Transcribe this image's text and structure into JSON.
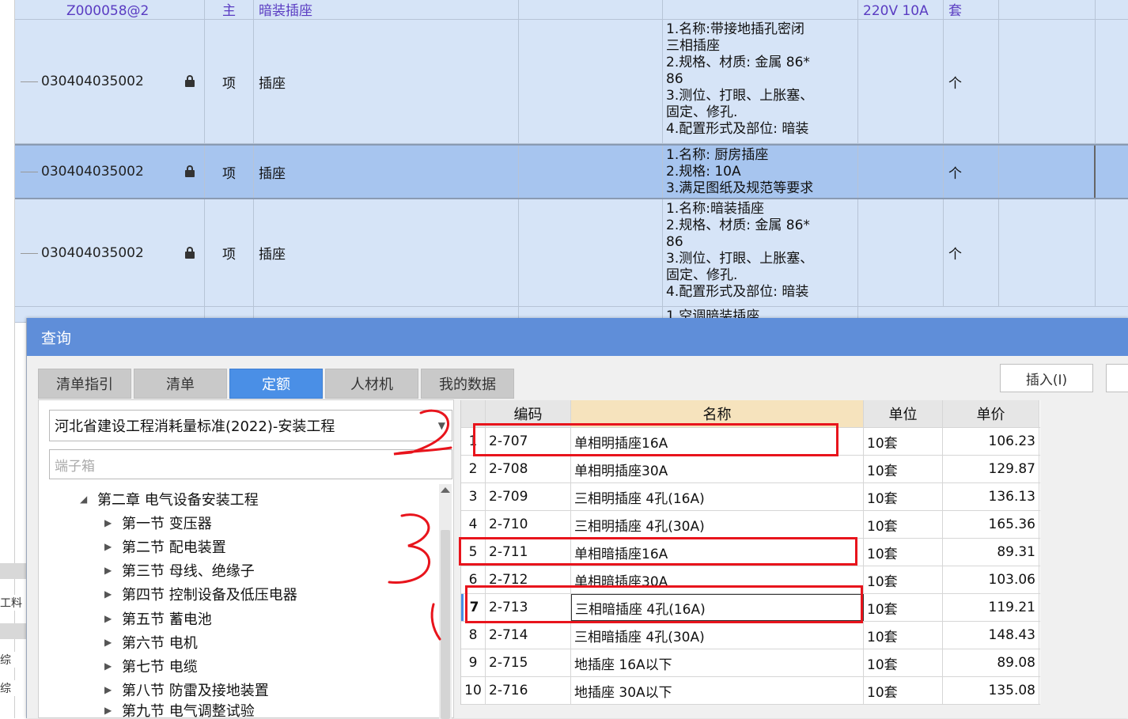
{
  "grid": {
    "top_row": {
      "code": "Z000058@2",
      "type": "主",
      "name": "暗装插座",
      "spec": "220V 10A",
      "unit": "套"
    },
    "rows": [
      {
        "code": "030404035002",
        "type": "项",
        "name": "插座",
        "desc": "1.名称:带接地插孔密闭\n三相插座\n2.规格、材质: 金属 86*\n86\n3.测位、打眼、上胀塞、\n固定、修孔.\n4.配置形式及部位: 暗装",
        "unit": "个"
      },
      {
        "code": "030404035002",
        "type": "项",
        "name": "插座",
        "desc": "1.名称: 厨房插座\n2.规格: 10A\n3.满足图纸及规范等要求",
        "unit": "个"
      },
      {
        "code": "030404035002",
        "type": "项",
        "name": "插座",
        "desc": "1.名称:暗装插座\n2.规格、材质: 金属 86*\n86\n3.测位、打眼、上胀塞、\n固定、修孔.\n4.配置形式及部位: 暗装",
        "unit": "个"
      }
    ],
    "partial_row_desc": "1.空调暗装插座"
  },
  "dialog": {
    "title": "查询",
    "tabs": [
      "清单指引",
      "清单",
      "定额",
      "人材机",
      "我的数据"
    ],
    "active_tab": "定额",
    "insert_button": "插入(I)",
    "library_select": "河北省建设工程消耗量标准(2022)-安装工程",
    "search_value": "端子箱",
    "tree": {
      "chapter": "第二章 电气设备安装工程",
      "sections": [
        "第一节 变压器",
        "第二节 配电装置",
        "第三节 母线、绝缘子",
        "第四节 控制设备及低压电器",
        "第五节 蓄电池",
        "第六节 电机",
        "第七节 电缆",
        "第八节 防雷及接地装置",
        "第九节 电气调整试验"
      ]
    },
    "table": {
      "headers": {
        "code": "编码",
        "name": "名称",
        "unit": "单位",
        "price": "单价"
      },
      "rows": [
        {
          "idx": "1",
          "code": "2-707",
          "name": "单相明插座16A",
          "unit": "10套",
          "price": "106.23"
        },
        {
          "idx": "2",
          "code": "2-708",
          "name": "单相明插座30A",
          "unit": "10套",
          "price": "129.87"
        },
        {
          "idx": "3",
          "code": "2-709",
          "name": "三相明插座 4孔(16A)",
          "unit": "10套",
          "price": "136.13"
        },
        {
          "idx": "4",
          "code": "2-710",
          "name": "三相明插座 4孔(30A)",
          "unit": "10套",
          "price": "165.36"
        },
        {
          "idx": "5",
          "code": "2-711",
          "name": "单相暗插座16A",
          "unit": "10套",
          "price": "89.31"
        },
        {
          "idx": "6",
          "code": "2-712",
          "name": "单相暗插座30A",
          "unit": "10套",
          "price": "103.06"
        },
        {
          "idx": "7",
          "code": "2-713",
          "name": "三相暗插座 4孔(16A)",
          "unit": "10套",
          "price": "119.21"
        },
        {
          "idx": "8",
          "code": "2-714",
          "name": "三相暗插座 4孔(30A)",
          "unit": "10套",
          "price": "148.43"
        },
        {
          "idx": "9",
          "code": "2-715",
          "name": "地插座 16A以下",
          "unit": "10套",
          "price": "89.08"
        },
        {
          "idx": "10",
          "code": "2-716",
          "name": "地插座 30A以下",
          "unit": "10套",
          "price": "135.08"
        }
      ],
      "selected_idx": "7"
    }
  },
  "left_edge_text": [
    "工料",
    "综",
    "综"
  ],
  "colors": {
    "accent": "#4a8fe6",
    "title_bar": "#5f8ed9",
    "annotation_red": "#e8141c",
    "row_selected": "#a7c5ef"
  }
}
